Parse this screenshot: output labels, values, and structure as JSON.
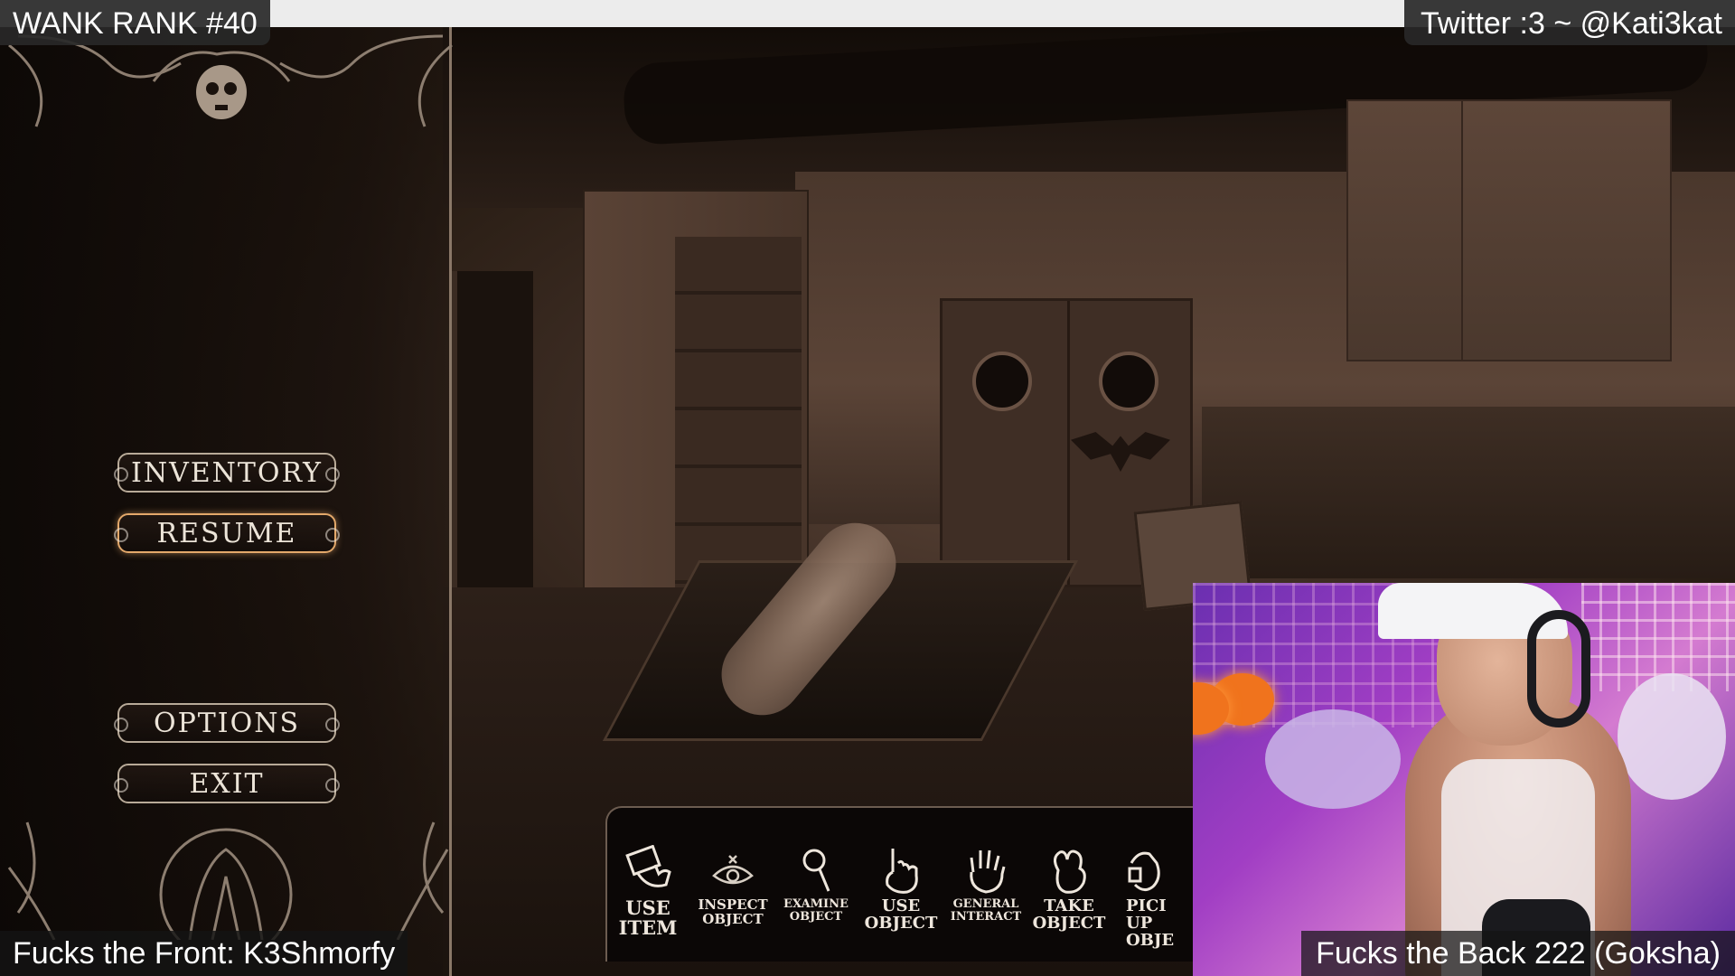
{
  "overlay": {
    "title": "WANK RANK #40",
    "twitter": "Twitter :3 ~ @Kati3kat",
    "bottom_left": "Fucks the Front: K3Shmorfy",
    "bottom_right": "Fucks the Back 222 (Goksha)"
  },
  "pause_menu": {
    "inventory": "INVENTORY",
    "resume": "RESUME",
    "options": "OPTIONS",
    "exit": "EXIT",
    "active_item": "resume"
  },
  "actions": [
    {
      "line1": "USE",
      "line2": "ITEM",
      "icon": "hand-card-icon",
      "size": "large"
    },
    {
      "line1": "INSPECT",
      "line2": "OBJECT",
      "icon": "eye-icon",
      "size": "small"
    },
    {
      "line1": "EXAMINE",
      "line2": "OBJECT",
      "icon": "magnifier-icon",
      "size": "tiny"
    },
    {
      "line1": "USE",
      "line2": "OBJECT",
      "icon": "pointing-hand-icon",
      "size": "medium"
    },
    {
      "line1": "GENERAL",
      "line2": "INTERACT",
      "icon": "open-hand-icon",
      "size": "tiny"
    },
    {
      "line1": "TAKE",
      "line2": "OBJECT",
      "icon": "grab-hand-icon",
      "size": "medium"
    },
    {
      "line1": "PICI",
      "line2": "UP",
      "line3": "OBJE",
      "icon": "pickup-hand-icon",
      "size": "medium"
    }
  ],
  "colors": {
    "menu_border": "#b8aa98",
    "menu_active_glow": "#e3a86a",
    "overlay_bg": "#282828",
    "webcam_accent": "#a13ec4"
  }
}
